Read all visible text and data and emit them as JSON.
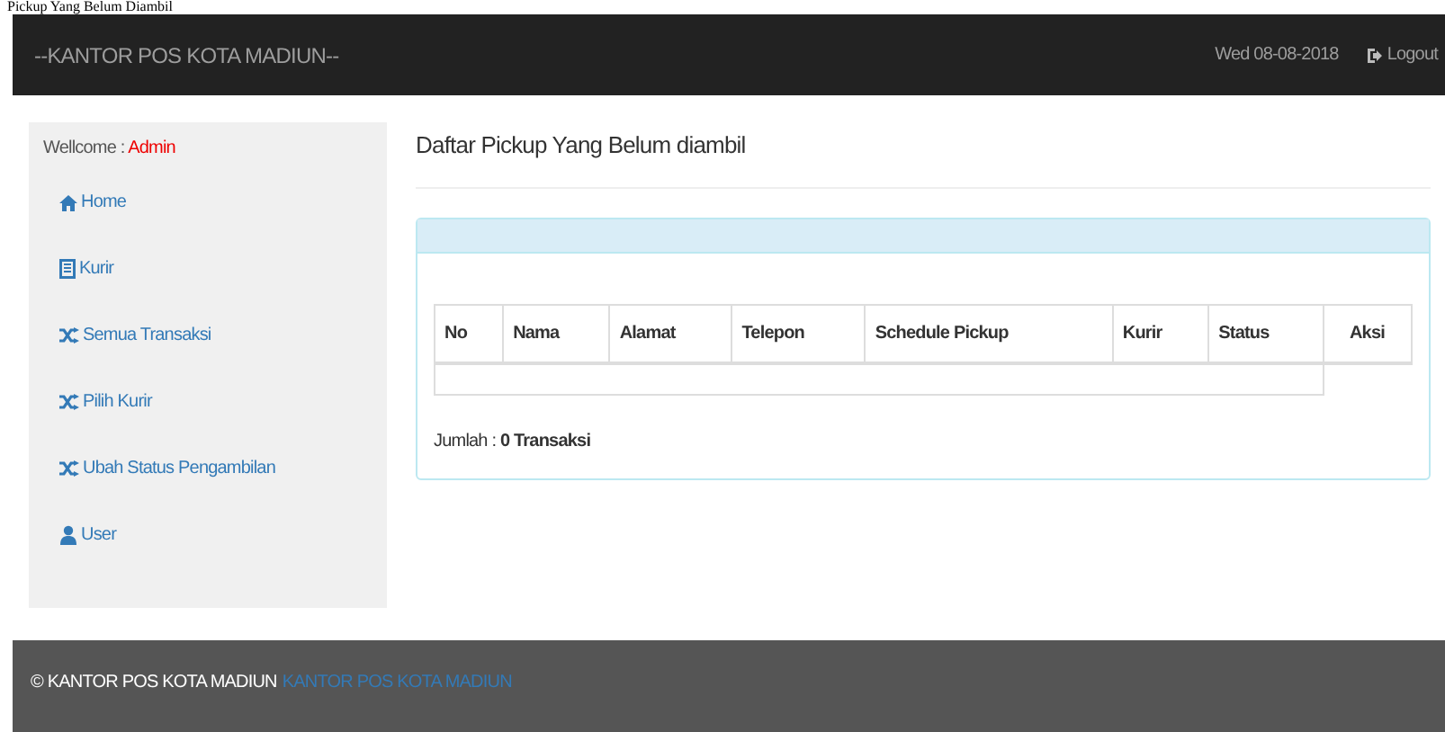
{
  "page_caption": "Pickup Yang Belum Diambil",
  "navbar": {
    "brand": "--KANTOR POS KOTA MADIUN--",
    "date": "Wed 08-08-2018",
    "logout": "Logout"
  },
  "sidebar": {
    "welcome_label": "Wellcome : ",
    "user": "Admin",
    "items": [
      {
        "label": "Home",
        "kind": "home"
      },
      {
        "label": "Kurir",
        "kind": "list"
      },
      {
        "label": "Semua Transaksi",
        "kind": "shuffle"
      },
      {
        "label": "Pilih Kurir",
        "kind": "shuffle"
      },
      {
        "label": "Ubah Status Pengambilan",
        "kind": "shuffle"
      },
      {
        "label": "User",
        "kind": "user"
      }
    ]
  },
  "main": {
    "title": "Daftar Pickup Yang Belum diambil",
    "table": {
      "columns": [
        "No",
        "Nama",
        "Alamat",
        "Telepon",
        "Schedule Pickup",
        "Kurir",
        "Status",
        "Aksi"
      ]
    },
    "total_label": "Jumlah : ",
    "total_value": "0 Transaksi"
  },
  "footer": {
    "copyright": "© KANTOR POS KOTA MADIUN",
    "link": "KANTOR POS KOTA MADIUN"
  }
}
